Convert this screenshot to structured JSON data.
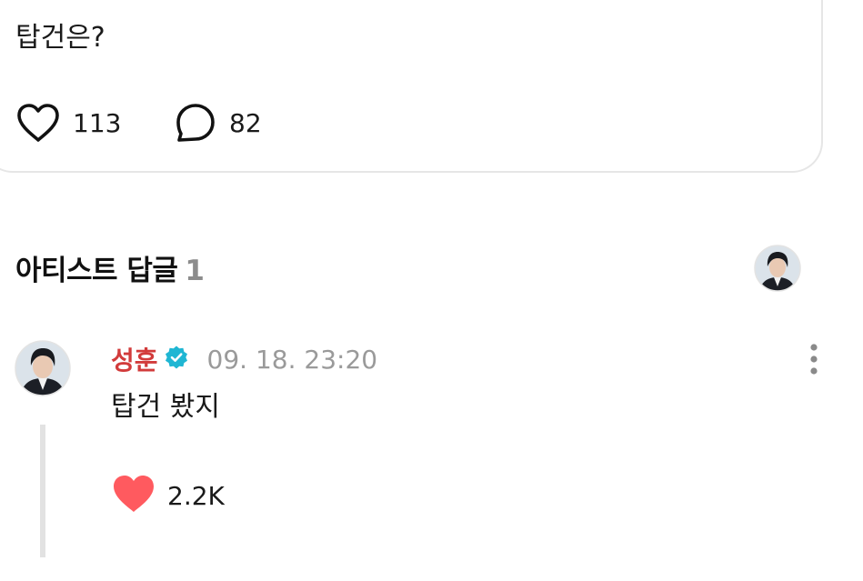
{
  "post": {
    "text": "탑건은?",
    "like_count": "113",
    "comment_count": "82"
  },
  "artist_replies": {
    "title": "아티스트 답글",
    "count": "1"
  },
  "reply": {
    "author": "성훈",
    "timestamp": "09. 18. 23:20",
    "text": "탑건 봤지",
    "like_count": "2.2K"
  },
  "icons": {
    "like": "heart-outline-icon",
    "comment": "speech-bubble-icon",
    "verified": "verified-badge-icon",
    "more": "more-vertical-icon",
    "reply_like": "heart-filled-icon"
  },
  "colors": {
    "author_name": "#d23b3b",
    "verified_badge": "#1fb6d3",
    "liked_heart": "#ff5a5f",
    "muted_text": "#9a9a9a"
  }
}
